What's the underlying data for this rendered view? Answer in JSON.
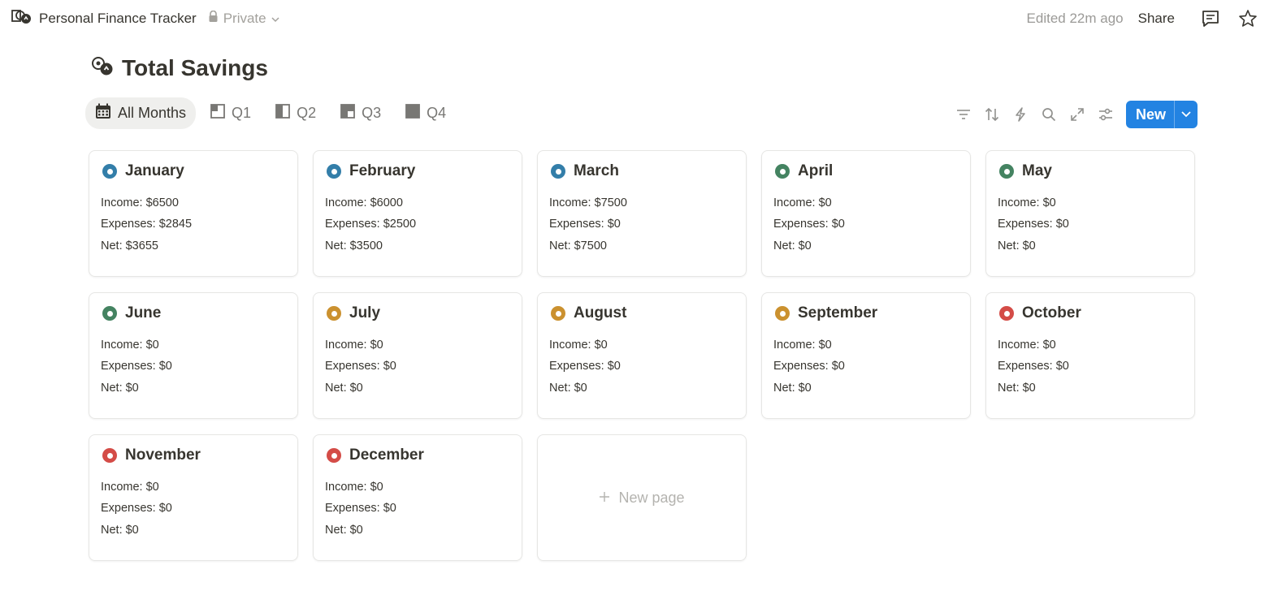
{
  "topbar": {
    "workspace_title": "Personal Finance Tracker",
    "privacy_label": "Private",
    "edited": "Edited 22m ago",
    "share_label": "Share"
  },
  "page": {
    "title": "Total Savings"
  },
  "views": [
    {
      "label": "All Months",
      "icon": "calendar-icon",
      "active": true
    },
    {
      "label": "Q1",
      "icon": "quarter-1-icon",
      "active": false
    },
    {
      "label": "Q2",
      "icon": "quarter-2-icon",
      "active": false
    },
    {
      "label": "Q3",
      "icon": "quarter-3-icon",
      "active": false
    },
    {
      "label": "Q4",
      "icon": "quarter-4-icon",
      "active": false
    }
  ],
  "toolbar": {
    "new_label": "New"
  },
  "status_colors": {
    "blue": "#337ea9",
    "green": "#448361",
    "orange": "#cb912f",
    "red": "#d44c47"
  },
  "cards": [
    {
      "name": "January",
      "status": "blue",
      "income": "Income: $6500",
      "expenses": "Expenses: $2845",
      "net": "Net: $3655"
    },
    {
      "name": "February",
      "status": "blue",
      "income": "Income: $6000",
      "expenses": "Expenses: $2500",
      "net": "Net: $3500"
    },
    {
      "name": "March",
      "status": "blue",
      "income": "Income: $7500",
      "expenses": "Expenses: $0",
      "net": "Net: $7500"
    },
    {
      "name": "April",
      "status": "green",
      "income": "Income: $0",
      "expenses": "Expenses: $0",
      "net": "Net: $0"
    },
    {
      "name": "May",
      "status": "green",
      "income": "Income: $0",
      "expenses": "Expenses: $0",
      "net": "Net: $0"
    },
    {
      "name": "June",
      "status": "green",
      "income": "Income: $0",
      "expenses": "Expenses: $0",
      "net": "Net: $0"
    },
    {
      "name": "July",
      "status": "orange",
      "income": "Income: $0",
      "expenses": "Expenses: $0",
      "net": "Net: $0"
    },
    {
      "name": "August",
      "status": "orange",
      "income": "Income: $0",
      "expenses": "Expenses: $0",
      "net": "Net: $0"
    },
    {
      "name": "September",
      "status": "orange",
      "income": "Income: $0",
      "expenses": "Expenses: $0",
      "net": "Net: $0"
    },
    {
      "name": "October",
      "status": "red",
      "income": "Income: $0",
      "expenses": "Expenses: $0",
      "net": "Net: $0"
    },
    {
      "name": "November",
      "status": "red",
      "income": "Income: $0",
      "expenses": "Expenses: $0",
      "net": "Net: $0"
    },
    {
      "name": "December",
      "status": "red",
      "income": "Income: $0",
      "expenses": "Expenses: $0",
      "net": "Net: $0"
    }
  ],
  "new_page_label": "New page"
}
